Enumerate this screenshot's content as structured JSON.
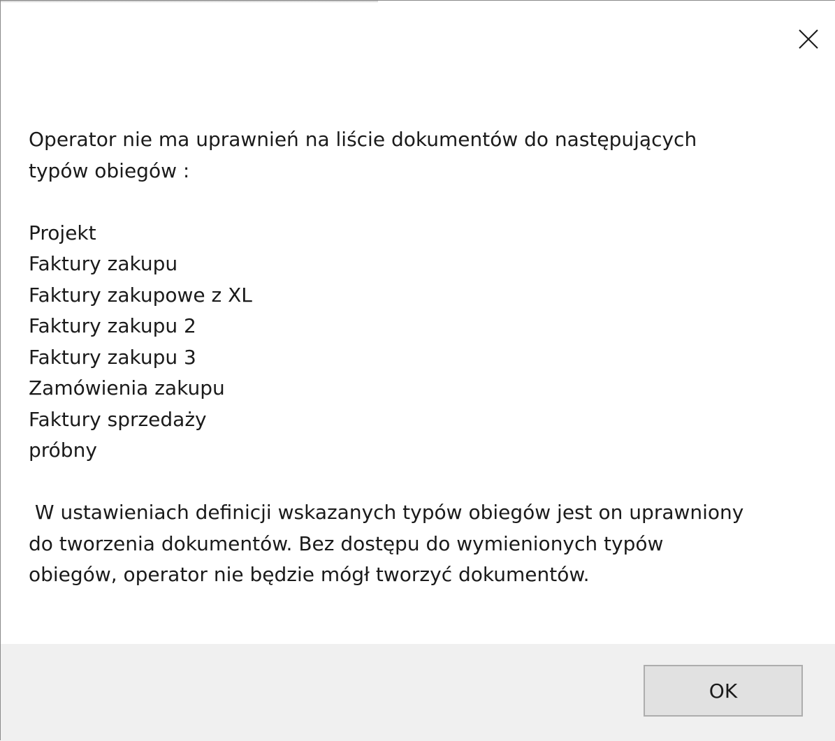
{
  "dialog": {
    "close_icon": "close-icon",
    "message": {
      "intro_line1": "Operator nie ma uprawnień na liście dokumentów do następujących",
      "intro_line2": "typów obiegów :",
      "workflow_types": [
        "Projekt",
        "Faktury zakupu",
        "Faktury zakupowe z XL",
        "Faktury zakupu 2",
        "Faktury zakupu 3",
        "Zamówienia zakupu",
        "Faktury sprzedaży",
        "próbny"
      ],
      "outro_line1": " W ustawieniach definicji wskazanych typów obiegów jest on uprawniony",
      "outro_line2": "do tworzenia dokumentów. Bez dostępu do wymienionych typów",
      "outro_line3": "obiegów, operator nie będzie mógł tworzyć dokumentów."
    },
    "buttons": {
      "ok_label": "OK"
    }
  }
}
